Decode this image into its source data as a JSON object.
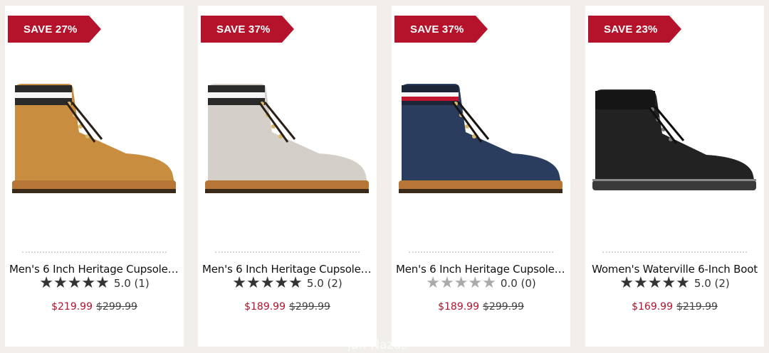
{
  "products": [
    {
      "badge": "SAVE 27%",
      "title": "Men's 6 Inch Heritage Cupsole ...",
      "rating": "5.0 (1)",
      "stars_filled": 5,
      "price_now": "$219.99",
      "price_was": "$299.99",
      "boot_color": "#c98d3f",
      "collar_color": "#2a2a2a",
      "sole_color": "#b57636",
      "star_color": "#333333"
    },
    {
      "badge": "SAVE 37%",
      "title": "Men's 6 Inch Heritage Cupsole ...",
      "rating": "5.0 (2)",
      "stars_filled": 5,
      "price_now": "$189.99",
      "price_was": "$299.99",
      "boot_color": "#d4cfc8",
      "collar_color": "#2a2a2a",
      "sole_color": "#b57636",
      "star_color": "#333333"
    },
    {
      "badge": "SAVE 37%",
      "title": "Men's 6 Inch Heritage Cupsole ...",
      "rating": "0.0 (0)",
      "stars_filled": 0,
      "price_now": "$189.99",
      "price_was": "$299.99",
      "boot_color": "#2b3d5e",
      "collar_color": "#1c2438",
      "sole_color": "#b57636",
      "star_color": "#aaaaaa"
    },
    {
      "badge": "SAVE 23%",
      "title": "Women's Waterville 6-Inch Boot",
      "rating": "5.0 (2)",
      "stars_filled": 5,
      "price_now": "$169.99",
      "price_was": "$219.99",
      "boot_color": "#222222",
      "collar_color": "#151515",
      "sole_color": "#3a3a3a",
      "star_color": "#333333"
    }
  ],
  "colors": {
    "badge": "#b5122b",
    "price_now": "#b5122b",
    "background": "#f2efea"
  },
  "watermark": "Jan-Nazus"
}
